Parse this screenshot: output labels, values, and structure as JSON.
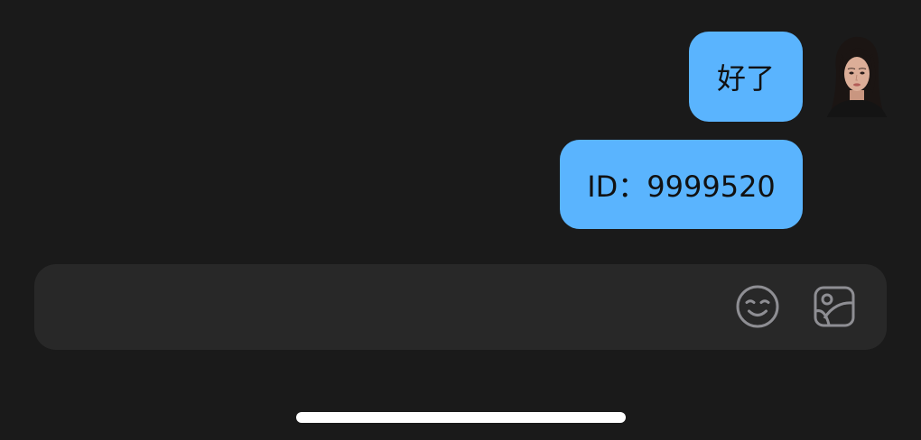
{
  "messages": [
    {
      "text": "好了",
      "side": "right"
    },
    {
      "text": "ID：9999520",
      "side": "right"
    }
  ],
  "composer": {
    "emoji_icon": "smile-face-icon",
    "image_icon": "image-picker-icon"
  },
  "colors": {
    "background": "#1a1a1a",
    "bubble": "#5ab4fe",
    "input_bar": "#282828",
    "icon": "#8e8e93",
    "home_indicator": "#ffffff"
  }
}
